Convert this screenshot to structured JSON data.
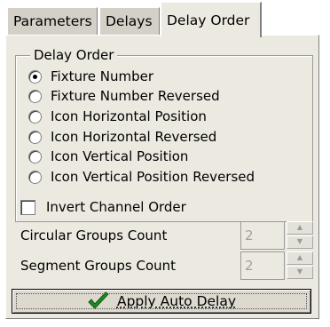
{
  "tabs": [
    {
      "label": "Parameters",
      "active": false
    },
    {
      "label": "Delays",
      "active": false
    },
    {
      "label": "Delay Order",
      "active": true
    }
  ],
  "delay_order": {
    "title": "Delay Order",
    "selected_index": 0,
    "options": [
      "Fixture Number",
      "Fixture Number Reversed",
      "Icon Horizontal Position",
      "Icon Horizontal Reversed",
      "Icon Vertical Position",
      "Icon Vertical Position Reversed"
    ]
  },
  "invert_channel_order": {
    "label": "Invert Channel Order",
    "checked": false
  },
  "circular_groups": {
    "label": "Circular Groups Count",
    "value": "2"
  },
  "segment_groups": {
    "label": "Segment Groups Count",
    "value": "2"
  },
  "apply_button": {
    "label": "Apply Auto Delay",
    "icon": "green-checkmark-icon"
  },
  "colors": {
    "checkmark": "#1e8a1e",
    "panel": "#ece9e1"
  }
}
